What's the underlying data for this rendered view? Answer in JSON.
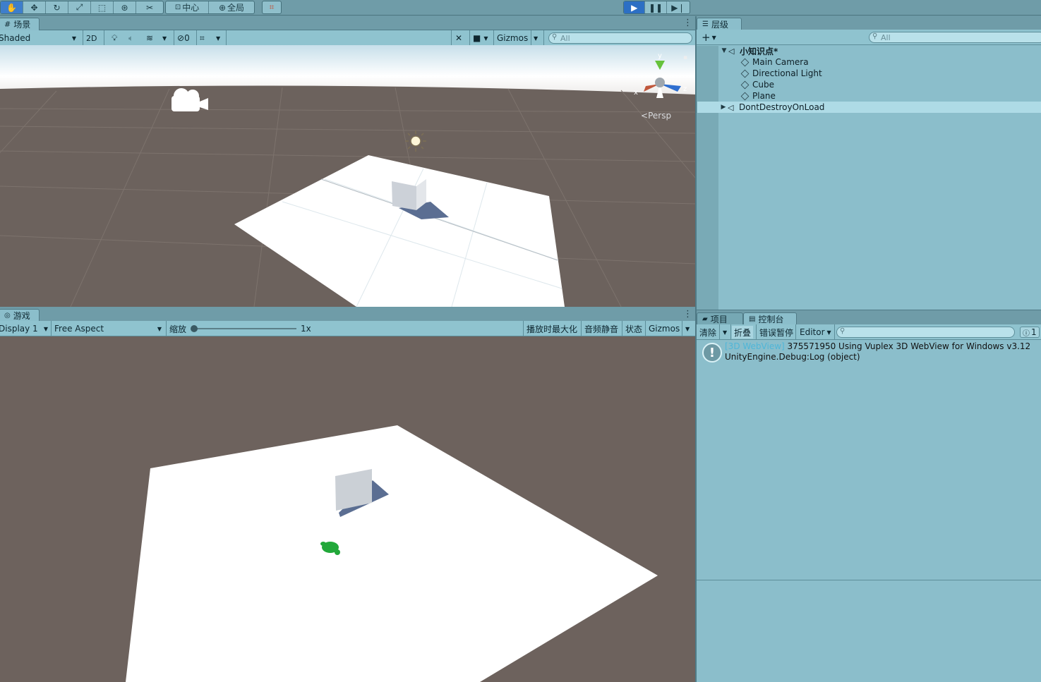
{
  "toolbar": {
    "pivot_label": "中心",
    "global_label": "全局"
  },
  "scene": {
    "tab_label": "场景",
    "shading_mode": "Shaded",
    "toggle_2d": "2D",
    "hidden_count": "0",
    "gizmos_label": "Gizmos",
    "search_placeholder": "All",
    "persp_label": "Persp",
    "axis_x": "x",
    "axis_y": "y",
    "axis_z": "z"
  },
  "game": {
    "tab_label": "游戏",
    "display": "Display 1",
    "aspect": "Free Aspect",
    "scale_label": "缩放",
    "scale_value": 0.0,
    "scale_text": "1x",
    "maximize_on_play": "播放时最大化",
    "mute_audio": "音频静音",
    "stats": "状态",
    "gizmos_label": "Gizmos"
  },
  "hierarchy": {
    "tab_label": "层级",
    "search_placeholder": "All",
    "scene_name": "小知识点*",
    "items": [
      {
        "label": "Main Camera"
      },
      {
        "label": "Directional Light"
      },
      {
        "label": "Cube"
      },
      {
        "label": "Plane"
      }
    ],
    "ddol_label": "DontDestroyOnLoad"
  },
  "bottom_right": {
    "tabs": [
      {
        "label": "项目"
      },
      {
        "label": "控制台"
      }
    ],
    "clear_label": "清除",
    "collapse_label": "折叠",
    "error_pause_label": "错误暂停",
    "editor_label": "Editor",
    "info_count": "1",
    "log": {
      "tag": "[3D WebView]",
      "message": "375571950 Using Vuplex 3D WebView for Windows v3.12",
      "trace": "UnityEngine.Debug:Log (object)"
    }
  },
  "colors": {
    "panel_bg": "#8bbecb",
    "toolbar_bg": "#6f9ca8",
    "viewport_ground": "#6d625d",
    "play_active": "#2c6fc4",
    "log_tag": "#4fb6d8"
  }
}
